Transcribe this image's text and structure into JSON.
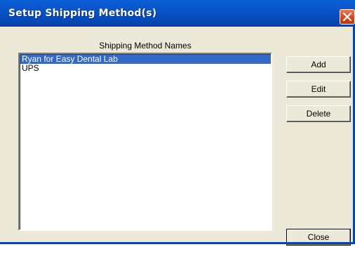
{
  "window": {
    "title": "Setup Shipping Method(s)"
  },
  "list": {
    "header": "Shipping Method Names",
    "items": [
      "Ryan for Easy Dental Lab",
      "UPS"
    ],
    "selected_index": 0
  },
  "buttons": {
    "add": "Add",
    "edit": "Edit",
    "delete": "Delete",
    "close": "Close"
  },
  "colors": {
    "titlebar": "#0850c4",
    "selection": "#316ac5",
    "dialog_bg": "#ece9d8",
    "close_button": "#d7461f"
  },
  "icons": {
    "close": "close-x-icon"
  }
}
